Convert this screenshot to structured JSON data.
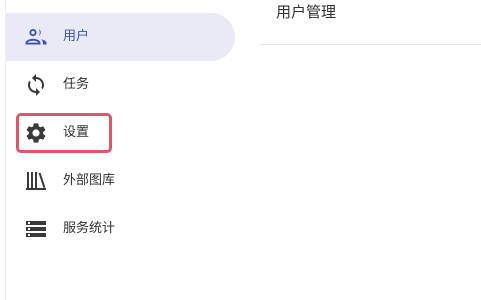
{
  "sidebar": {
    "items": [
      {
        "label": "用户",
        "icon": "users-icon",
        "active": true
      },
      {
        "label": "任务",
        "icon": "sync-icon",
        "active": false
      },
      {
        "label": "设置",
        "icon": "gear-icon",
        "active": false,
        "highlighted": true
      },
      {
        "label": "外部图库",
        "icon": "library-icon",
        "active": false
      },
      {
        "label": "服务统计",
        "icon": "server-icon",
        "active": false
      }
    ]
  },
  "main": {
    "title": "用户管理"
  },
  "colors": {
    "accent": "#3f51b5",
    "active_background": "#eaeaf6",
    "highlight_border": "#e0546c",
    "text": "#303030"
  }
}
